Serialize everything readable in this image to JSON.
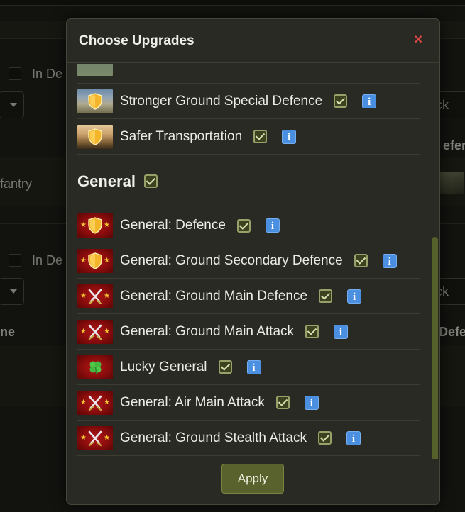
{
  "background": {
    "labels": {
      "in_defence_1": "In De",
      "infantry": "fantry",
      "in_defence_2": "In De",
      "col_name": "ne",
      "attack_1": "ack",
      "defence_col_1": "efen",
      "attack_2": "ack",
      "defence_col_2": "Defe"
    }
  },
  "modal": {
    "title": "Choose Upgrades",
    "close_label": "×",
    "top_items": [
      {
        "label": "Stronger Ground Special Defence",
        "icon": "shield-icon"
      },
      {
        "label": "Safer Transportation",
        "icon": "shield-icon"
      }
    ],
    "section": {
      "title": "General",
      "items": [
        {
          "label": "General: Defence",
          "icon": "general-shield-icon"
        },
        {
          "label": "General: Ground Secondary Defence",
          "icon": "general-shield-icon"
        },
        {
          "label": "General: Ground Main Defence",
          "icon": "crossed-swords-icon"
        },
        {
          "label": "General: Ground Main Attack",
          "icon": "crossed-swords-icon"
        },
        {
          "label": "Lucky General",
          "icon": "four-leaf-clover-icon"
        },
        {
          "label": "General: Air Main Attack",
          "icon": "crossed-swords-icon"
        },
        {
          "label": "General: Ground Stealth Attack",
          "icon": "crossed-swords-icon"
        }
      ]
    },
    "info_label": "i",
    "apply_label": "Apply"
  },
  "colors": {
    "accent": "#59612c",
    "close": "#e04848",
    "info": "#4a8fe0"
  }
}
